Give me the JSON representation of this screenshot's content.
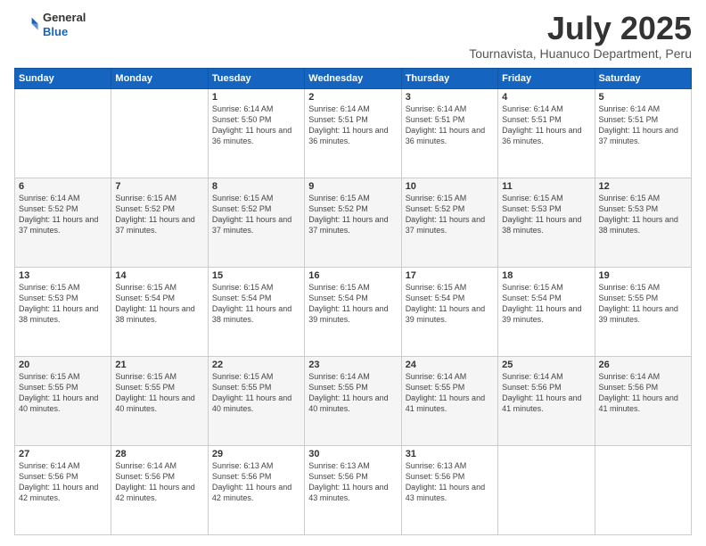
{
  "header": {
    "logo": {
      "general": "General",
      "blue": "Blue"
    },
    "title": "July 2025",
    "location": "Tournavista, Huanuco Department, Peru"
  },
  "days_of_week": [
    "Sunday",
    "Monday",
    "Tuesday",
    "Wednesday",
    "Thursday",
    "Friday",
    "Saturday"
  ],
  "weeks": [
    [
      {
        "day": "",
        "info": ""
      },
      {
        "day": "",
        "info": ""
      },
      {
        "day": "1",
        "info": "Sunrise: 6:14 AM\nSunset: 5:50 PM\nDaylight: 11 hours\nand 36 minutes."
      },
      {
        "day": "2",
        "info": "Sunrise: 6:14 AM\nSunset: 5:51 PM\nDaylight: 11 hours\nand 36 minutes."
      },
      {
        "day": "3",
        "info": "Sunrise: 6:14 AM\nSunset: 5:51 PM\nDaylight: 11 hours\nand 36 minutes."
      },
      {
        "day": "4",
        "info": "Sunrise: 6:14 AM\nSunset: 5:51 PM\nDaylight: 11 hours\nand 36 minutes."
      },
      {
        "day": "5",
        "info": "Sunrise: 6:14 AM\nSunset: 5:51 PM\nDaylight: 11 hours\nand 37 minutes."
      }
    ],
    [
      {
        "day": "6",
        "info": "Sunrise: 6:14 AM\nSunset: 5:52 PM\nDaylight: 11 hours\nand 37 minutes."
      },
      {
        "day": "7",
        "info": "Sunrise: 6:15 AM\nSunset: 5:52 PM\nDaylight: 11 hours\nand 37 minutes."
      },
      {
        "day": "8",
        "info": "Sunrise: 6:15 AM\nSunset: 5:52 PM\nDaylight: 11 hours\nand 37 minutes."
      },
      {
        "day": "9",
        "info": "Sunrise: 6:15 AM\nSunset: 5:52 PM\nDaylight: 11 hours\nand 37 minutes."
      },
      {
        "day": "10",
        "info": "Sunrise: 6:15 AM\nSunset: 5:52 PM\nDaylight: 11 hours\nand 37 minutes."
      },
      {
        "day": "11",
        "info": "Sunrise: 6:15 AM\nSunset: 5:53 PM\nDaylight: 11 hours\nand 38 minutes."
      },
      {
        "day": "12",
        "info": "Sunrise: 6:15 AM\nSunset: 5:53 PM\nDaylight: 11 hours\nand 38 minutes."
      }
    ],
    [
      {
        "day": "13",
        "info": "Sunrise: 6:15 AM\nSunset: 5:53 PM\nDaylight: 11 hours\nand 38 minutes."
      },
      {
        "day": "14",
        "info": "Sunrise: 6:15 AM\nSunset: 5:54 PM\nDaylight: 11 hours\nand 38 minutes."
      },
      {
        "day": "15",
        "info": "Sunrise: 6:15 AM\nSunset: 5:54 PM\nDaylight: 11 hours\nand 38 minutes."
      },
      {
        "day": "16",
        "info": "Sunrise: 6:15 AM\nSunset: 5:54 PM\nDaylight: 11 hours\nand 39 minutes."
      },
      {
        "day": "17",
        "info": "Sunrise: 6:15 AM\nSunset: 5:54 PM\nDaylight: 11 hours\nand 39 minutes."
      },
      {
        "day": "18",
        "info": "Sunrise: 6:15 AM\nSunset: 5:54 PM\nDaylight: 11 hours\nand 39 minutes."
      },
      {
        "day": "19",
        "info": "Sunrise: 6:15 AM\nSunset: 5:55 PM\nDaylight: 11 hours\nand 39 minutes."
      }
    ],
    [
      {
        "day": "20",
        "info": "Sunrise: 6:15 AM\nSunset: 5:55 PM\nDaylight: 11 hours\nand 40 minutes."
      },
      {
        "day": "21",
        "info": "Sunrise: 6:15 AM\nSunset: 5:55 PM\nDaylight: 11 hours\nand 40 minutes."
      },
      {
        "day": "22",
        "info": "Sunrise: 6:15 AM\nSunset: 5:55 PM\nDaylight: 11 hours\nand 40 minutes."
      },
      {
        "day": "23",
        "info": "Sunrise: 6:14 AM\nSunset: 5:55 PM\nDaylight: 11 hours\nand 40 minutes."
      },
      {
        "day": "24",
        "info": "Sunrise: 6:14 AM\nSunset: 5:55 PM\nDaylight: 11 hours\nand 41 minutes."
      },
      {
        "day": "25",
        "info": "Sunrise: 6:14 AM\nSunset: 5:56 PM\nDaylight: 11 hours\nand 41 minutes."
      },
      {
        "day": "26",
        "info": "Sunrise: 6:14 AM\nSunset: 5:56 PM\nDaylight: 11 hours\nand 41 minutes."
      }
    ],
    [
      {
        "day": "27",
        "info": "Sunrise: 6:14 AM\nSunset: 5:56 PM\nDaylight: 11 hours\nand 42 minutes."
      },
      {
        "day": "28",
        "info": "Sunrise: 6:14 AM\nSunset: 5:56 PM\nDaylight: 11 hours\nand 42 minutes."
      },
      {
        "day": "29",
        "info": "Sunrise: 6:13 AM\nSunset: 5:56 PM\nDaylight: 11 hours\nand 42 minutes."
      },
      {
        "day": "30",
        "info": "Sunrise: 6:13 AM\nSunset: 5:56 PM\nDaylight: 11 hours\nand 43 minutes."
      },
      {
        "day": "31",
        "info": "Sunrise: 6:13 AM\nSunset: 5:56 PM\nDaylight: 11 hours\nand 43 minutes."
      },
      {
        "day": "",
        "info": ""
      },
      {
        "day": "",
        "info": ""
      }
    ]
  ]
}
